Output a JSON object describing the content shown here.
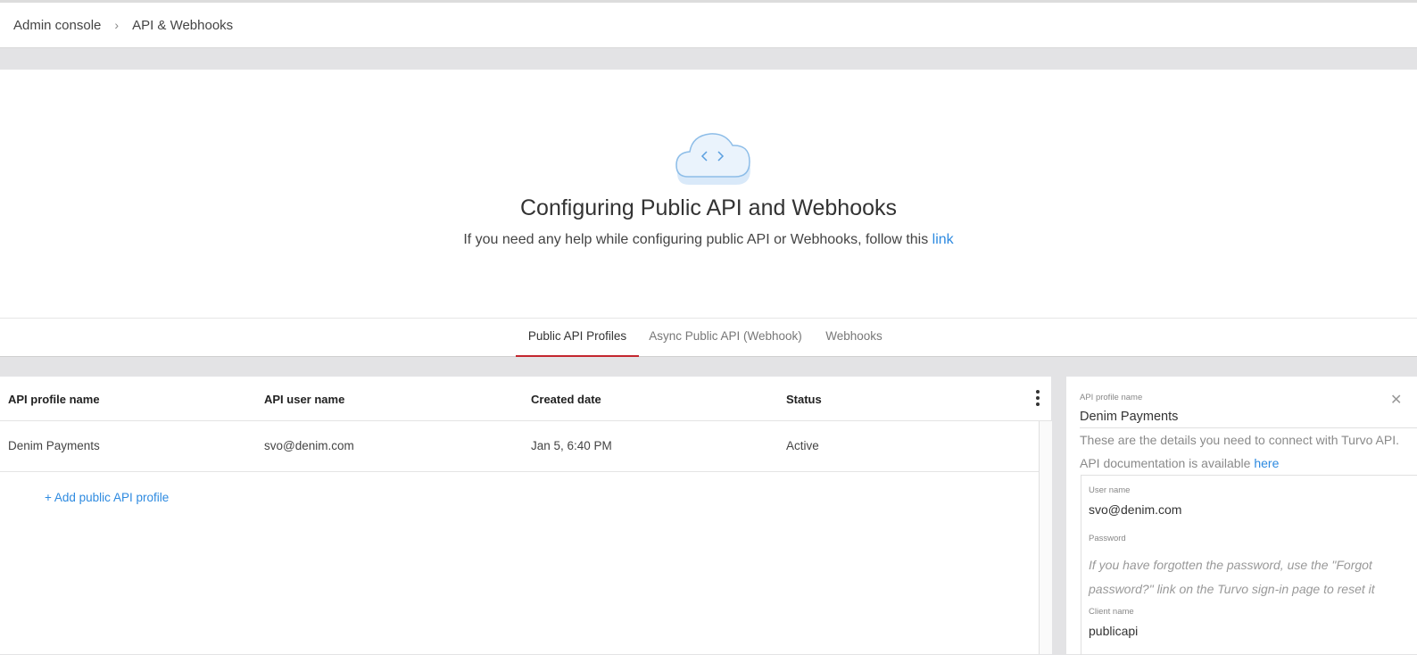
{
  "breadcrumb": {
    "root": "Admin console",
    "separator": "›",
    "current": "API & Webhooks"
  },
  "hero": {
    "icon": "cloud-code-icon",
    "title": "Configuring Public API and Webhooks",
    "subtitle": "If you need any help while configuring public API or Webhooks, follow this",
    "link_text": "link"
  },
  "tabs": [
    {
      "label": "Public API Profiles",
      "active": true
    },
    {
      "label": "Async Public API (Webhook)",
      "active": false
    },
    {
      "label": "Webhooks",
      "active": false
    }
  ],
  "table": {
    "columns": [
      "API profile name",
      "API user name",
      "Created date",
      "Status"
    ],
    "rows": [
      {
        "profile_name": "Denim Payments",
        "user_name": "svo@denim.com",
        "created": "Jan 5, 6:40 PM",
        "status": "Active"
      }
    ],
    "add_label": "+ Add public API profile",
    "menu_icon": "more-vertical-icon"
  },
  "details": {
    "profile_label": "API profile name",
    "profile_value": "Denim Payments",
    "info_line1": "These are the details you need to connect with Turvo API.",
    "info_line2": "API documentation is available",
    "doc_link": "here",
    "user_label": "User name",
    "user_value": "svo@denim.com",
    "password_label": "Password",
    "password_hint": "If you have forgotten the password, use the \"Forgot password?\" link on the Turvo sign-in page to reset it",
    "client_label": "Client name",
    "client_value": "publicapi",
    "close_icon": "close-icon"
  },
  "colors": {
    "accent_link": "#2d8ae0",
    "active_tab_underline": "#c3262e",
    "background": "#e3e3e5"
  }
}
